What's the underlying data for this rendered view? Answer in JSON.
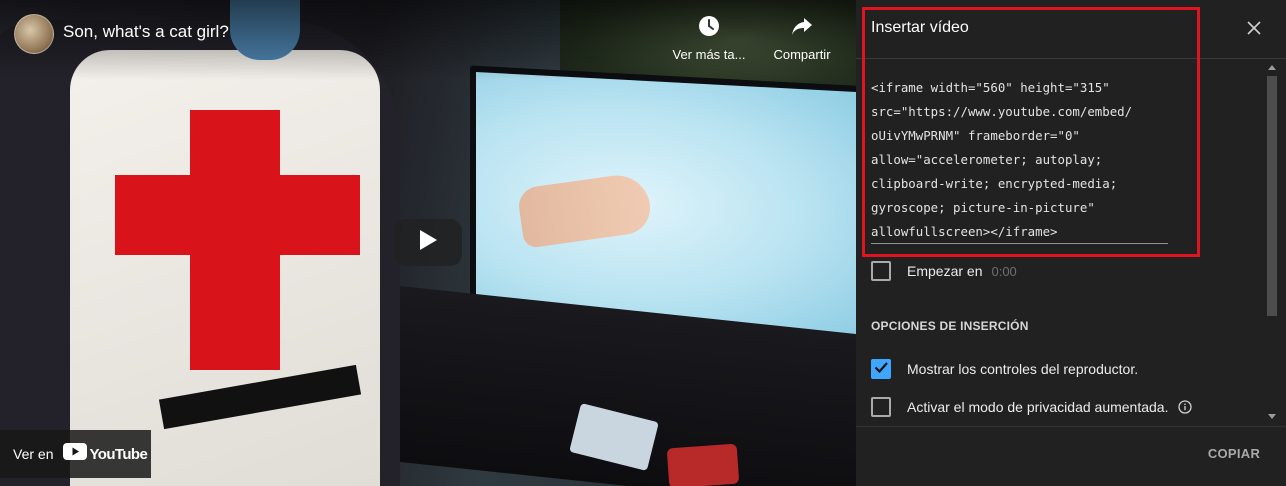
{
  "video": {
    "title": "Son, what's a cat girl?",
    "watch_later_label": "Ver más ta...",
    "share_label": "Compartir",
    "watch_on_label": "Ver en",
    "youtube_wordmark": "YouTube"
  },
  "embed_panel": {
    "title": "Insertar vídeo",
    "code": "<iframe width=\"560\" height=\"315\"\nsrc=\"https://www.youtube.com/embed/\noUivYMwPRNM\" frameborder=\"0\"\nallow=\"accelerometer; autoplay;\nclipboard-write; encrypted-media;\ngyroscope; picture-in-picture\"\nallowfullscreen></iframe>",
    "start_at": {
      "label": "Empezar en",
      "value": "0:00",
      "checked": false
    },
    "options_heading": "OPCIONES DE INSERCIÓN",
    "options": [
      {
        "label": "Mostrar los controles del reproductor.",
        "checked": true
      },
      {
        "label": "Activar el modo de privacidad aumentada.",
        "checked": false
      }
    ],
    "copy_label": "COPIAR"
  },
  "colors": {
    "highlight_border": "#e0141e",
    "checkbox_checked": "#3ea6ff",
    "panel_background": "#212121"
  }
}
